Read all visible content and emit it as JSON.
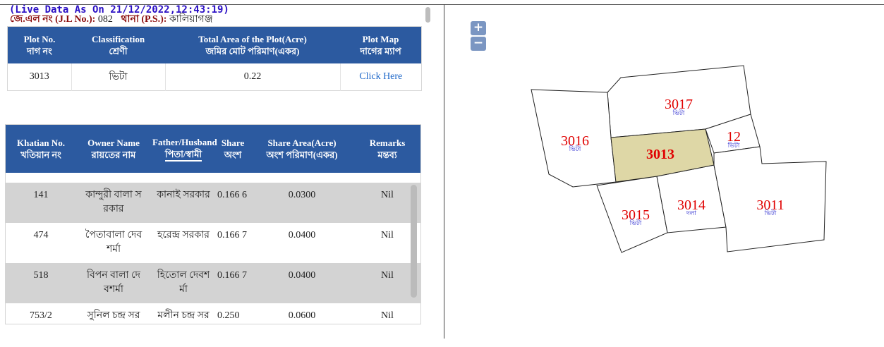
{
  "header": {
    "live_data": "(Live Data As On 21/12/2022,12:43:19)",
    "jl_label": "জে.এল নং (J.L No.):",
    "jl_value": "082",
    "ps_label": "থানা (P.S.):",
    "ps_value": "কালিয়াগঞ্জ"
  },
  "plot_table": {
    "headers": [
      {
        "en": "Plot No.",
        "bn": "দাগ নং"
      },
      {
        "en": "Classification",
        "bn": "শ্রেণী"
      },
      {
        "en": "Total Area of the Plot(Acre)",
        "bn": "জমির মোট পরিমাণ(একর)"
      },
      {
        "en": "Plot Map",
        "bn": "দাগের ম্যাপ"
      }
    ],
    "row": {
      "plot_no": "3013",
      "classification": "ভিটা",
      "area": "0.22",
      "map_link": "Click Here"
    }
  },
  "owner_table": {
    "headers": [
      {
        "en": "Khatian No.",
        "bn": "খতিয়ান নং"
      },
      {
        "en": "Owner Name",
        "bn": "রায়তের নাম"
      },
      {
        "en": "Father/Husband",
        "bn": "পিতা/স্বামী"
      },
      {
        "en": "Share",
        "bn": "অংশ"
      },
      {
        "en": "Share Area(Acre)",
        "bn": "অংশ পরিমাণ(একর)"
      },
      {
        "en": "Remarks",
        "bn": "মন্তব্য"
      }
    ],
    "rows": [
      {
        "khatian": "141",
        "owner": "কান্দুরী বালা স রকার",
        "father": "কানাই সরকার",
        "share": "0.166 6",
        "share_area": "0.0300",
        "remarks": "Nil"
      },
      {
        "khatian": "474",
        "owner": "পৈতাবালা দেব শর্মা",
        "father": "হরেন্দ্র সরকার",
        "share": "0.166 7",
        "share_area": "0.0400",
        "remarks": "Nil"
      },
      {
        "khatian": "518",
        "owner": "বিপন বালা দে বশর্মা",
        "father": "হিতোল দেবশ র্মা",
        "share": "0.166 7",
        "share_area": "0.0400",
        "remarks": "Nil"
      },
      {
        "khatian": "753/2",
        "owner": "সুনিল চন্দ্র সর",
        "father": "মলীন চন্দ্র সর",
        "share": "0.250",
        "share_area": "0.0600",
        "remarks": "Nil"
      }
    ]
  },
  "map": {
    "zoom_in": "+",
    "zoom_out": "−",
    "selected_fill": "#ded7a6",
    "plots": [
      {
        "no": "3017",
        "cls": "ভিটা"
      },
      {
        "no": "3016",
        "cls": "ভিটা"
      },
      {
        "no": "3013",
        "cls": ""
      },
      {
        "no": "12",
        "cls": "ভিটা"
      },
      {
        "no": "3015",
        "cls": "ভিটা"
      },
      {
        "no": "3014",
        "cls": "দলা"
      },
      {
        "no": "3011",
        "cls": "ভিটা"
      }
    ]
  }
}
